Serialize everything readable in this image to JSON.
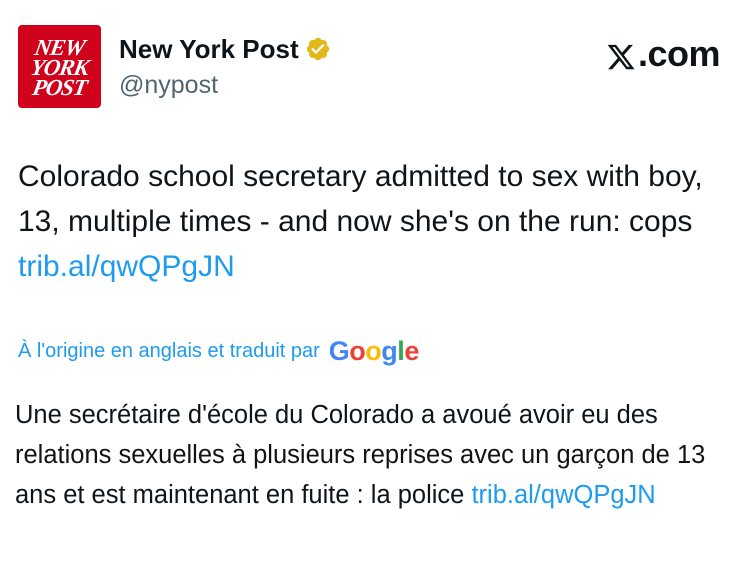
{
  "account": {
    "logo_lines": [
      "NEW",
      "YORK",
      "POST"
    ],
    "display_name": "New York Post",
    "handle": "@nypost",
    "verified_icon": "gold-verified-badge-icon"
  },
  "brand": {
    "site": ".com",
    "site_icon": "x-logo-icon"
  },
  "tweet": {
    "text": "Colorado school secretary admitted to sex with boy, 13, multiple times - and now she's on the run: cops ",
    "link": "trib.al/qwQPgJN"
  },
  "translation": {
    "note": "À l'origine en anglais et traduit par",
    "provider": [
      "G",
      "o",
      "o",
      "g",
      "l",
      "e"
    ],
    "text": "Une secrétaire d'école du Colorado a avoué avoir eu des relations sexuelles à plusieurs reprises avec un garçon de 13 ans et est maintenant en fuite : la police ",
    "link": "trib.al/qwQPgJN"
  },
  "colors": {
    "link": "#1d9bf0",
    "verified_gold": "#e2b719",
    "avatar_red": "#d0021b"
  }
}
